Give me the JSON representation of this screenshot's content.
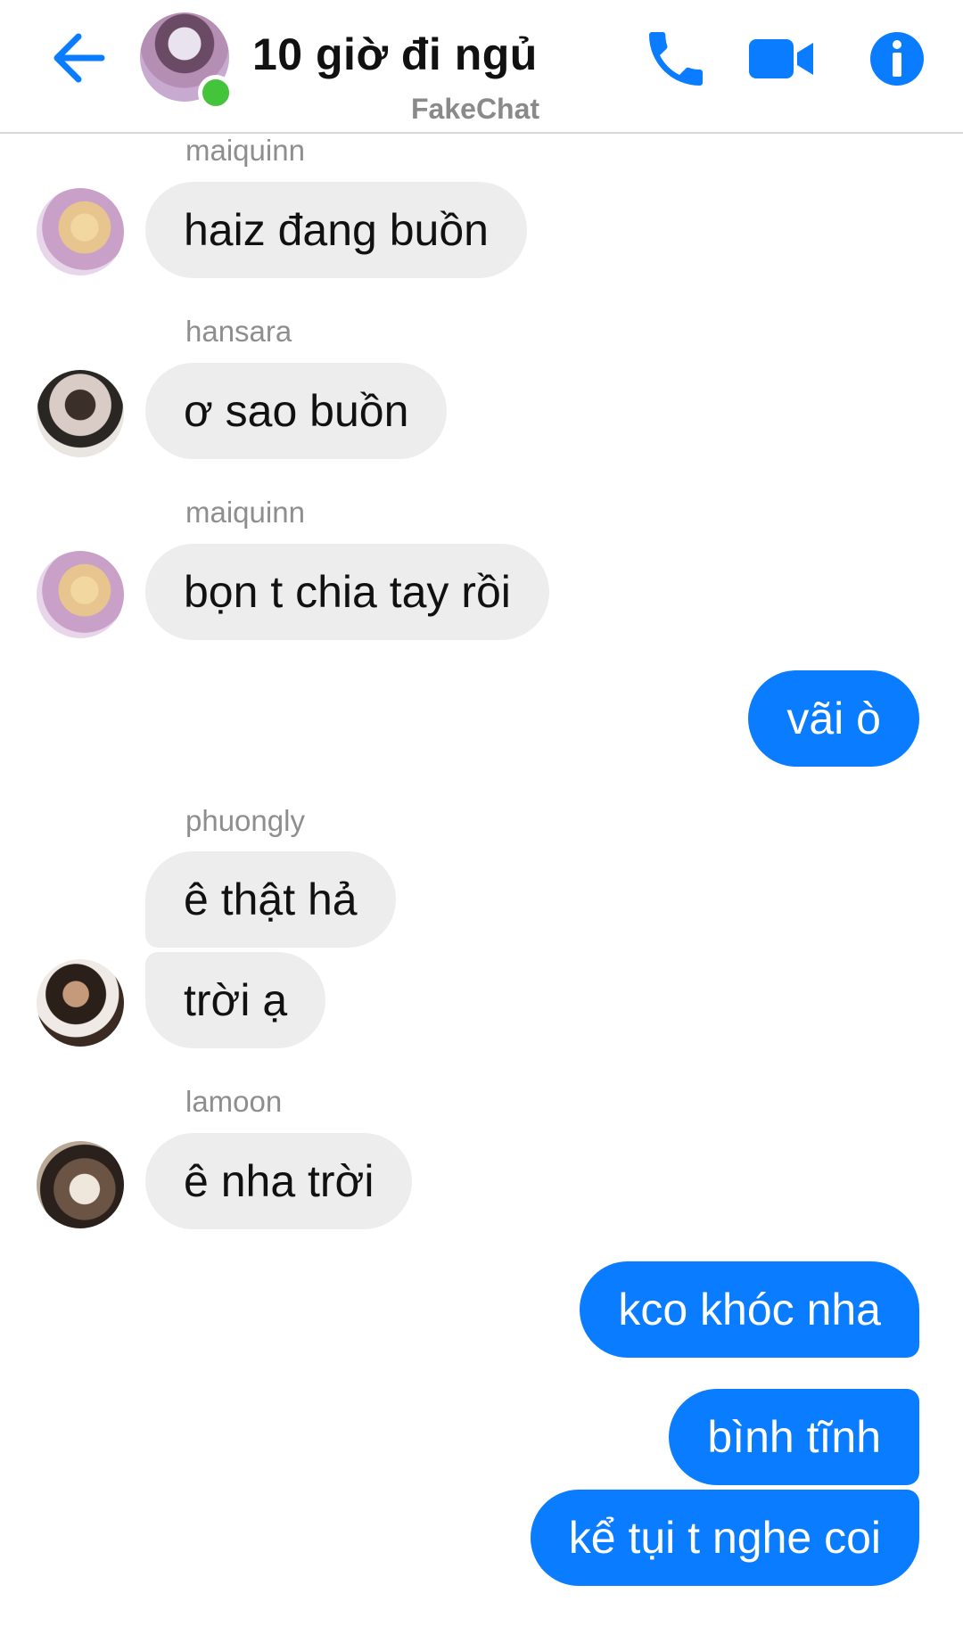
{
  "header": {
    "title": "10 giờ đi ngủ",
    "subtitle": "FakeChat",
    "back_icon": "arrow-left-icon",
    "call_icon": "phone-icon",
    "video_icon": "video-camera-icon",
    "info_icon": "info-icon",
    "accent_color": "#0a7cff",
    "online_color": "#44c43a"
  },
  "messages": [
    {
      "sender": "maiquinn",
      "text": "haiz đang buồn"
    },
    {
      "sender": "hansara",
      "text": "ơ sao buồn"
    },
    {
      "sender": "maiquinn",
      "text": "bọn t chia tay rồi"
    },
    {
      "sender": "me",
      "text": "vãi ò"
    },
    {
      "sender": "phuongly",
      "text": "ê thật hả"
    },
    {
      "sender": "phuongly",
      "text": "trời ạ"
    },
    {
      "sender": "lamoon",
      "text": "ê nha trời"
    },
    {
      "sender": "me",
      "text": "kco khóc nha"
    },
    {
      "sender": "me",
      "text": "bình tĩnh"
    },
    {
      "sender": "me",
      "text": "kể tụi t nghe coi"
    }
  ],
  "colors": {
    "outgoing_bubble": "#0a7cff",
    "incoming_bubble": "#ededed",
    "sender_label": "#8e8e8e"
  }
}
